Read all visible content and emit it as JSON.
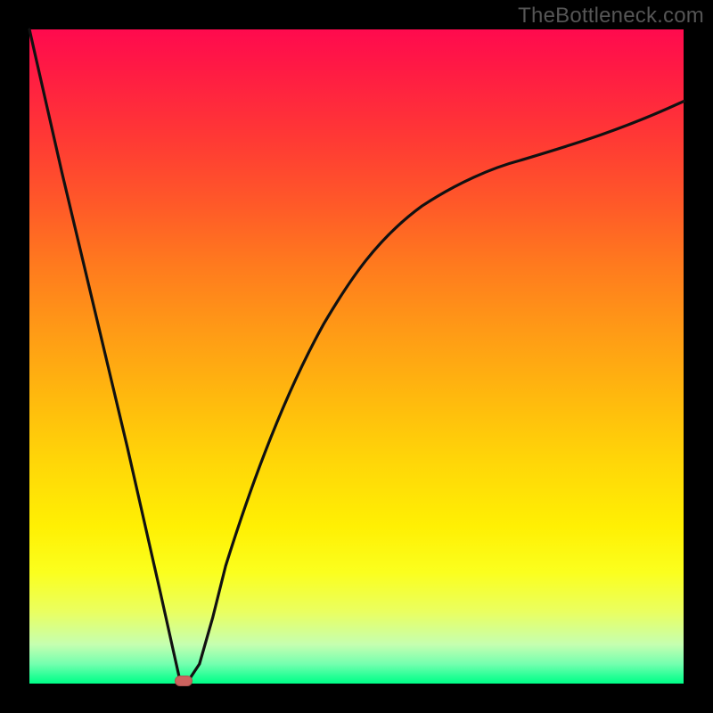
{
  "watermark": "TheBottleneck.com",
  "chart_data": {
    "type": "line",
    "title": "",
    "xlabel": "",
    "ylabel": "",
    "xlim": [
      0,
      100
    ],
    "ylim": [
      0,
      100
    ],
    "grid": false,
    "legend": false,
    "series": [
      {
        "name": "curve",
        "x": [
          0,
          5,
          10,
          15,
          20,
          22,
          23,
          24,
          26,
          28,
          30,
          35,
          40,
          45,
          50,
          55,
          60,
          65,
          70,
          75,
          80,
          85,
          90,
          95,
          100
        ],
        "y": [
          100,
          78,
          57,
          36,
          14,
          5,
          1,
          0,
          3,
          10,
          18,
          34,
          46,
          55,
          62,
          68,
          73,
          77,
          80,
          82.5,
          84.5,
          86,
          87.5,
          89,
          90
        ]
      }
    ],
    "marker": {
      "x": 23.5,
      "y": 0,
      "color": "#cc625e"
    },
    "background_gradient": [
      "#ff0a4e",
      "#ffd608",
      "#fff003",
      "#00ff88"
    ]
  }
}
